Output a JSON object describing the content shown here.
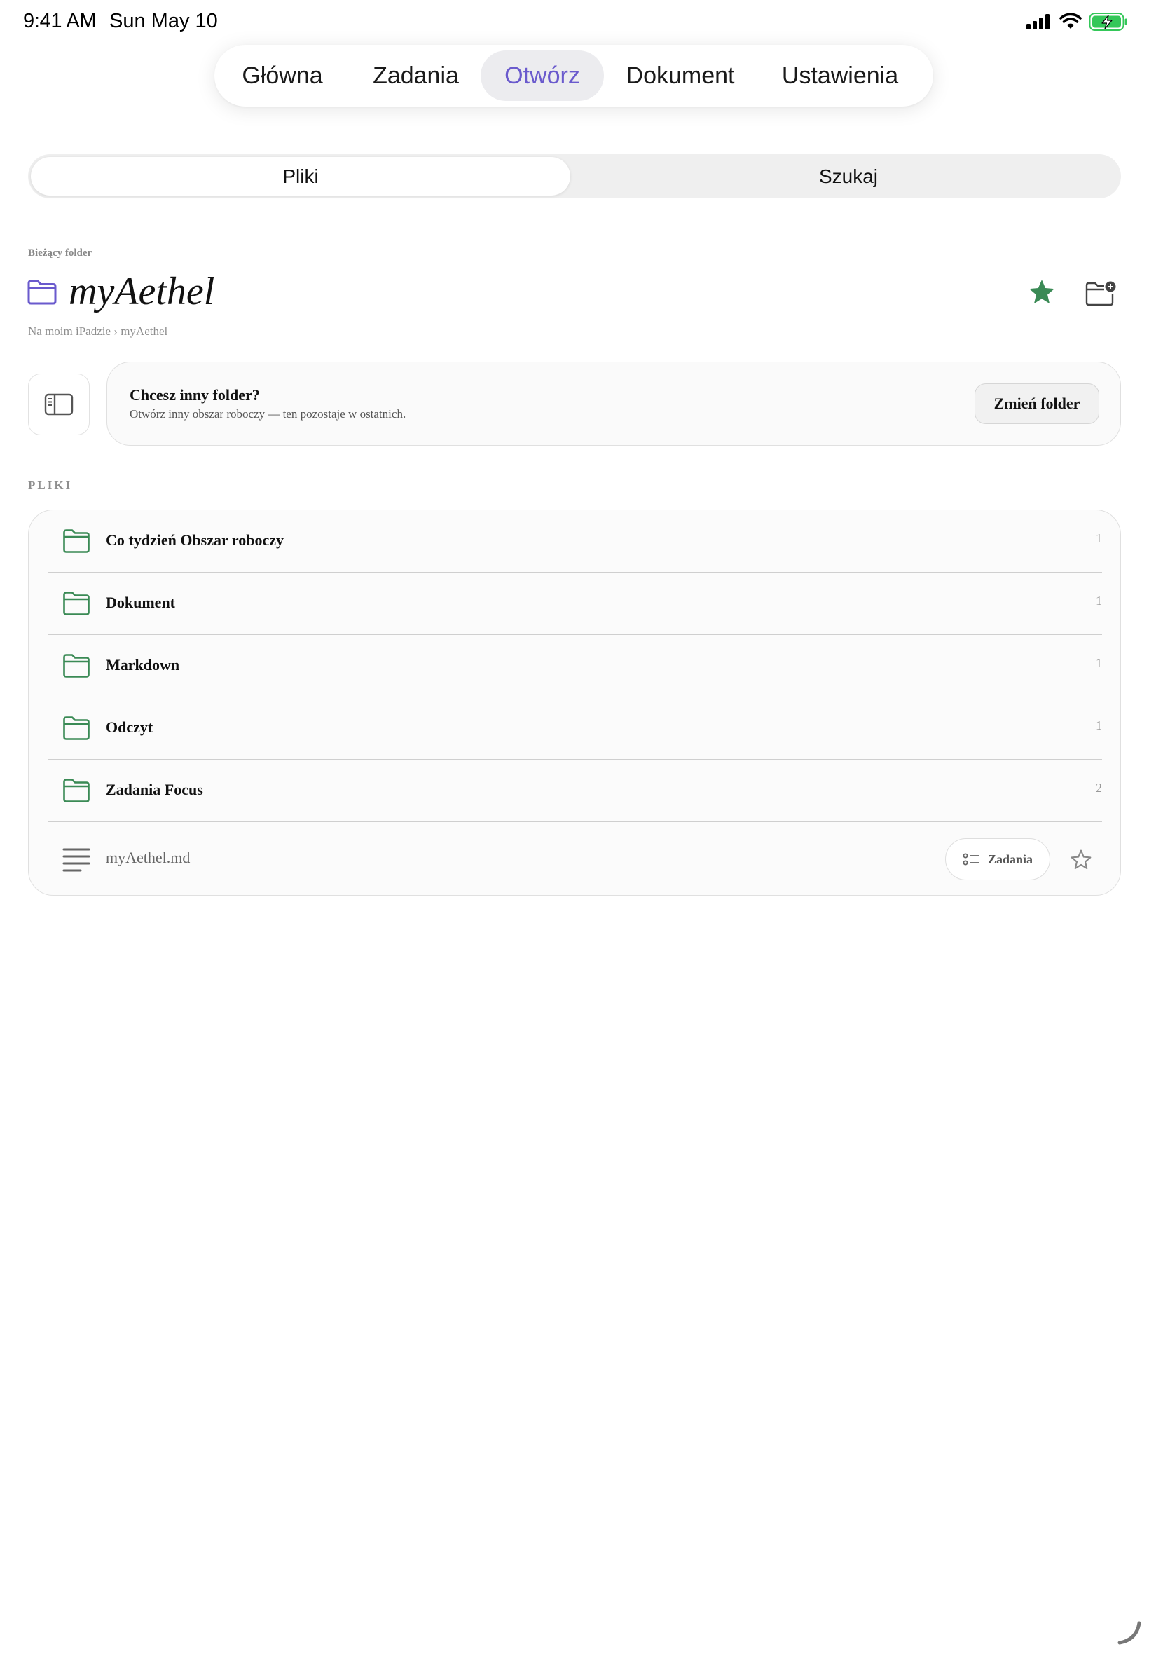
{
  "status_bar": {
    "time": "9:41 AM",
    "date": "Sun May 10",
    "icons": [
      "cellular-signal-icon",
      "wifi-icon",
      "battery-charging-icon"
    ],
    "battery_color": "#34c759"
  },
  "top_nav": {
    "tabs": [
      {
        "label": "Główna",
        "active": false
      },
      {
        "label": "Zadania",
        "active": false
      },
      {
        "label": "Otwórz",
        "active": true
      },
      {
        "label": "Dokument",
        "active": false
      },
      {
        "label": "Ustawienia",
        "active": false
      }
    ],
    "accent_color": "#6a5acd"
  },
  "segmented": {
    "items": [
      {
        "label": "Pliki",
        "active": true
      },
      {
        "label": "Szukaj",
        "active": false
      }
    ]
  },
  "current_folder": {
    "label": "Bieżący folder",
    "name": "myAethel",
    "breadcrumb": "Na moim iPadzie › myAethel",
    "folder_icon_color": "#6a5acd",
    "starred": true,
    "star_color": "#3a8a55"
  },
  "change_folder_card": {
    "title": "Chcesz inny folder?",
    "subtitle": "Otwórz inny obszar roboczy — ten pozostaje w ostatnich.",
    "button_label": "Zmień folder"
  },
  "files": {
    "section_label": "PLIKI",
    "folder_icon_color": "#3a8a55",
    "folders": [
      {
        "name": "Co tydzień Obszar roboczy",
        "count": "1"
      },
      {
        "name": "Dokument",
        "count": "1"
      },
      {
        "name": "Markdown",
        "count": "1"
      },
      {
        "name": "Odczyt",
        "count": "1"
      },
      {
        "name": "Zadania Focus",
        "count": "2"
      }
    ],
    "documents": [
      {
        "name": "myAethel.md",
        "tag": "Zadania",
        "starred": false
      }
    ]
  }
}
